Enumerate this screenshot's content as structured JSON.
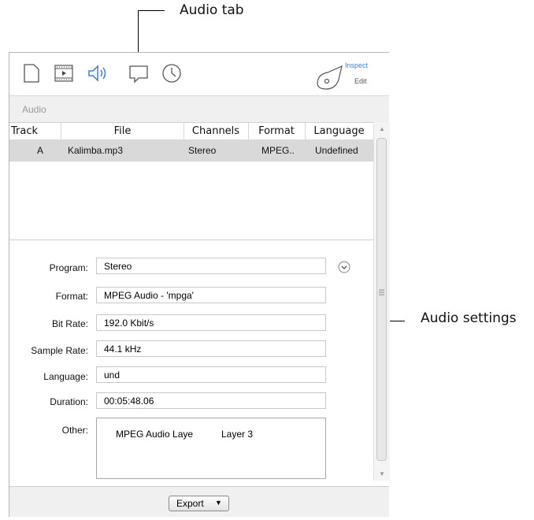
{
  "callouts": {
    "audio_tab": "Audio tab",
    "audio_settings": "Audio settings"
  },
  "toolbar": {
    "icons": [
      "document-icon",
      "film-icon",
      "speaker-icon",
      "comment-icon",
      "clock-icon"
    ],
    "inspect_label": "Inspect",
    "edit_label": "Edit",
    "accent": "#3a7fd5"
  },
  "section": {
    "title": "Audio"
  },
  "table": {
    "columns": [
      "Track",
      "File",
      "Channels",
      "Format",
      "Language"
    ],
    "rows": [
      {
        "track": "A",
        "file": "Kalimba.mp3",
        "channels": "Stereo",
        "format": "MPEG..",
        "language": "Undefined"
      }
    ]
  },
  "settings": {
    "program_label": "Program:",
    "program_value": "Stereo",
    "format_label": "Format:",
    "format_value": "MPEG Audio - 'mpga'",
    "bitrate_label": "Bit Rate:",
    "bitrate_value": "192.0 Kbit/s",
    "samplerate_label": "Sample Rate:",
    "samplerate_value": "44.1 kHz",
    "language_label": "Language:",
    "language_value": "und",
    "duration_label": "Duration:",
    "duration_value": "00:05:48.06",
    "other_label": "Other:",
    "other_key": "MPEG Audio Laye",
    "other_value": "Layer 3"
  },
  "footer": {
    "export_label": "Export"
  }
}
